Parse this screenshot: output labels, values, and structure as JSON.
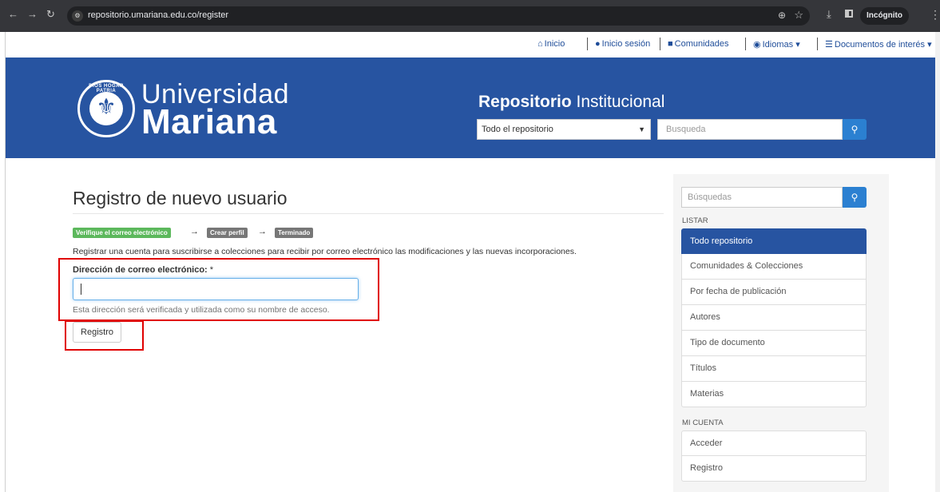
{
  "browser": {
    "url": "repositorio.umariana.edu.co/register",
    "incognito_label": "Incógnito"
  },
  "topnav": {
    "items": [
      {
        "label": "Inicio",
        "icon": "home-icon"
      },
      {
        "label": "Inicio sesión",
        "icon": "user-icon"
      },
      {
        "label": "Comunidades",
        "icon": "book-icon"
      },
      {
        "label": "Idiomas",
        "icon": "globe-icon"
      },
      {
        "label": "Documentos de interés",
        "icon": "list-icon"
      }
    ]
  },
  "header": {
    "logo_line1": "Universidad",
    "logo_line2": "Mariana",
    "seal_text": "DIOS HOGAR PATRIA",
    "repo_title_bold": "Repositorio",
    "repo_title_rest": " Institucional",
    "scope_selected": "Todo el repositorio",
    "search_placeholder": "Busqueda",
    "brand_color": "#2754a1"
  },
  "main": {
    "title": "Registro de nuevo usuario",
    "steps": [
      "Verifique el correo electrónico",
      "Crear perfil",
      "Terminado"
    ],
    "step_arrow": "→",
    "intro": "Registrar una cuenta para suscribirse a colecciones para recibir por correo electrónico las modificaciones y las nuevas incorporaciones.",
    "email_label": "Dirección de correo electrónico:",
    "required_mark": "*",
    "email_value": "",
    "help_text": "Esta dirección será verificada y utilizada como su nombre de acceso.",
    "register_button": "Registro"
  },
  "sidebar": {
    "search_placeholder": "Búsquedas",
    "browse_heading": "LISTAR",
    "browse_items": [
      "Todo repositorio",
      "Comunidades & Colecciones",
      "Por fecha de publicación",
      "Autores",
      "Tipo de documento",
      "Títulos",
      "Materias"
    ],
    "account_heading": "MI CUENTA",
    "account_items": [
      "Acceder",
      "Registro"
    ]
  }
}
